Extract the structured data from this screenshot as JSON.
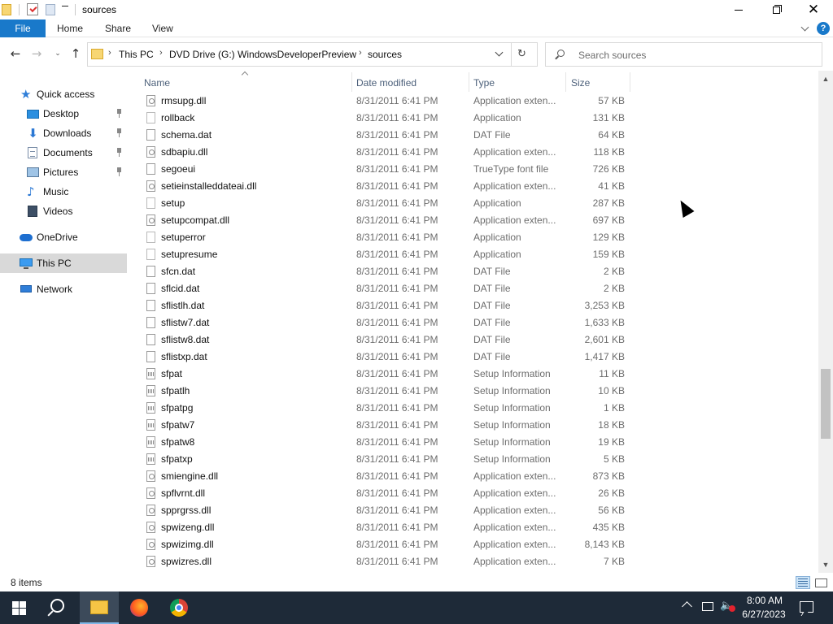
{
  "window": {
    "title": "sources",
    "buttons": {
      "minimize": "minimize",
      "maximize": "maximize",
      "close": "close"
    }
  },
  "ribbon": {
    "tabs": [
      {
        "label": "File"
      },
      {
        "label": "Home"
      },
      {
        "label": "Share"
      },
      {
        "label": "View"
      }
    ],
    "help_label": "?"
  },
  "nav": {
    "back": "←",
    "forward": "→",
    "recent": "⌄",
    "up": "↑",
    "breadcrumb": [
      {
        "label": "This PC"
      },
      {
        "label": "DVD Drive (G:) WindowsDeveloperPreview"
      },
      {
        "label": "sources"
      }
    ],
    "refresh": "↻",
    "search_placeholder": "Search sources"
  },
  "sidebar": {
    "items": [
      {
        "label": "Quick access",
        "icon": "star-icon",
        "pinned": false
      },
      {
        "label": "Desktop",
        "icon": "desktop-icon",
        "pinned": true
      },
      {
        "label": "Downloads",
        "icon": "download-icon",
        "pinned": true
      },
      {
        "label": "Documents",
        "icon": "documents-icon",
        "pinned": true
      },
      {
        "label": "Pictures",
        "icon": "pictures-icon",
        "pinned": true
      },
      {
        "label": "Music",
        "icon": "music-icon",
        "pinned": false
      },
      {
        "label": "Videos",
        "icon": "videos-icon",
        "pinned": false
      },
      {
        "label": "OneDrive",
        "icon": "onedrive-icon",
        "pinned": false
      },
      {
        "label": "This PC",
        "icon": "this-pc-icon",
        "pinned": false,
        "selected": true
      },
      {
        "label": "Network",
        "icon": "network-icon",
        "pinned": false
      }
    ]
  },
  "file_list": {
    "columns": [
      "Name",
      "Date modified",
      "Type",
      "Size"
    ],
    "sort_column": "Name",
    "rows": [
      {
        "name": "rmsupg.dll",
        "date": "8/31/2011 6:41 PM",
        "type": "Application exten...",
        "size": "57 KB",
        "icon": "dll"
      },
      {
        "name": "rollback",
        "date": "8/31/2011 6:41 PM",
        "type": "Application",
        "size": "131 KB",
        "icon": "exe"
      },
      {
        "name": "schema.dat",
        "date": "8/31/2011 6:41 PM",
        "type": "DAT File",
        "size": "64 KB",
        "icon": "file"
      },
      {
        "name": "sdbapiu.dll",
        "date": "8/31/2011 6:41 PM",
        "type": "Application exten...",
        "size": "118 KB",
        "icon": "dll"
      },
      {
        "name": "segoeui",
        "date": "8/31/2011 6:41 PM",
        "type": "TrueType font file",
        "size": "726 KB",
        "icon": "file"
      },
      {
        "name": "setieinstalleddateai.dll",
        "date": "8/31/2011 6:41 PM",
        "type": "Application exten...",
        "size": "41 KB",
        "icon": "dll"
      },
      {
        "name": "setup",
        "date": "8/31/2011 6:41 PM",
        "type": "Application",
        "size": "287 KB",
        "icon": "exe"
      },
      {
        "name": "setupcompat.dll",
        "date": "8/31/2011 6:41 PM",
        "type": "Application exten...",
        "size": "697 KB",
        "icon": "dll"
      },
      {
        "name": "setuperror",
        "date": "8/31/2011 6:41 PM",
        "type": "Application",
        "size": "129 KB",
        "icon": "exe"
      },
      {
        "name": "setupresume",
        "date": "8/31/2011 6:41 PM",
        "type": "Application",
        "size": "159 KB",
        "icon": "exe"
      },
      {
        "name": "sfcn.dat",
        "date": "8/31/2011 6:41 PM",
        "type": "DAT File",
        "size": "2 KB",
        "icon": "file"
      },
      {
        "name": "sflcid.dat",
        "date": "8/31/2011 6:41 PM",
        "type": "DAT File",
        "size": "2 KB",
        "icon": "file"
      },
      {
        "name": "sflistlh.dat",
        "date": "8/31/2011 6:41 PM",
        "type": "DAT File",
        "size": "3,253 KB",
        "icon": "file"
      },
      {
        "name": "sflistw7.dat",
        "date": "8/31/2011 6:41 PM",
        "type": "DAT File",
        "size": "1,633 KB",
        "icon": "file"
      },
      {
        "name": "sflistw8.dat",
        "date": "8/31/2011 6:41 PM",
        "type": "DAT File",
        "size": "2,601 KB",
        "icon": "file"
      },
      {
        "name": "sflistxp.dat",
        "date": "8/31/2011 6:41 PM",
        "type": "DAT File",
        "size": "1,417 KB",
        "icon": "file"
      },
      {
        "name": "sfpat",
        "date": "8/31/2011 6:41 PM",
        "type": "Setup Information",
        "size": "11 KB",
        "icon": "inf"
      },
      {
        "name": "sfpatlh",
        "date": "8/31/2011 6:41 PM",
        "type": "Setup Information",
        "size": "10 KB",
        "icon": "inf"
      },
      {
        "name": "sfpatpg",
        "date": "8/31/2011 6:41 PM",
        "type": "Setup Information",
        "size": "1 KB",
        "icon": "inf"
      },
      {
        "name": "sfpatw7",
        "date": "8/31/2011 6:41 PM",
        "type": "Setup Information",
        "size": "18 KB",
        "icon": "inf"
      },
      {
        "name": "sfpatw8",
        "date": "8/31/2011 6:41 PM",
        "type": "Setup Information",
        "size": "19 KB",
        "icon": "inf"
      },
      {
        "name": "sfpatxp",
        "date": "8/31/2011 6:41 PM",
        "type": "Setup Information",
        "size": "5 KB",
        "icon": "inf"
      },
      {
        "name": "smiengine.dll",
        "date": "8/31/2011 6:41 PM",
        "type": "Application exten...",
        "size": "873 KB",
        "icon": "dll"
      },
      {
        "name": "spflvrnt.dll",
        "date": "8/31/2011 6:41 PM",
        "type": "Application exten...",
        "size": "26 KB",
        "icon": "dll"
      },
      {
        "name": "spprgrss.dll",
        "date": "8/31/2011 6:41 PM",
        "type": "Application exten...",
        "size": "56 KB",
        "icon": "dll"
      },
      {
        "name": "spwizeng.dll",
        "date": "8/31/2011 6:41 PM",
        "type": "Application exten...",
        "size": "435 KB",
        "icon": "dll"
      },
      {
        "name": "spwizimg.dll",
        "date": "8/31/2011 6:41 PM",
        "type": "Application exten...",
        "size": "8,143 KB",
        "icon": "dll"
      },
      {
        "name": "spwizres.dll",
        "date": "8/31/2011 6:41 PM",
        "type": "Application exten...",
        "size": "7 KB",
        "icon": "dll"
      }
    ]
  },
  "status": {
    "item_count": "8 items"
  },
  "taskbar": {
    "apps": [
      "File Explorer",
      "Firefox",
      "Chrome"
    ],
    "active_app": "File Explorer",
    "time": "8:00 AM",
    "date": "6/27/2023"
  },
  "colors": {
    "accent": "#1979ca",
    "taskbar": "#1e2a38",
    "selection": "#d9d9d9",
    "header_text": "#4c607a"
  }
}
